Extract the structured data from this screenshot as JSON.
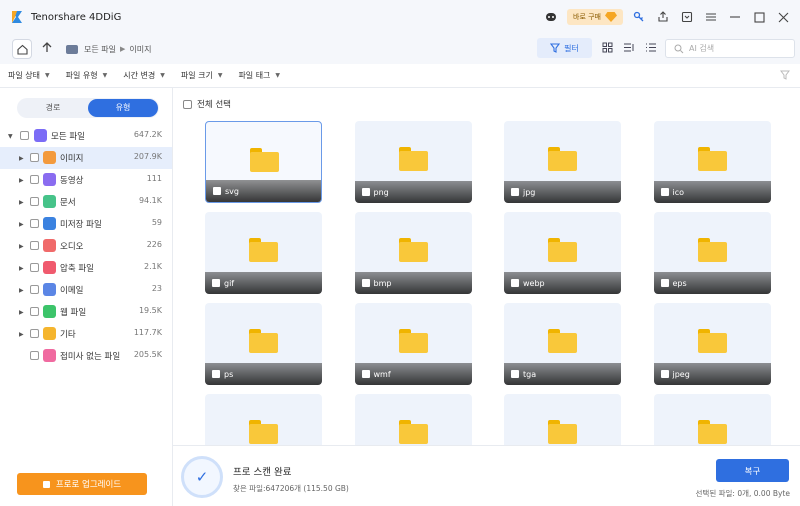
{
  "app": {
    "title": "Tenorshare 4DDiG",
    "buy_label": "바로 구매"
  },
  "breadcrumb": [
    "모든 파일",
    "이미지"
  ],
  "toolbar": {
    "filter_label": "필터",
    "ai_search_placeholder": "AI 검색"
  },
  "filters": [
    "파일 상태",
    "파일 유형",
    "시간 변경",
    "파일 크기",
    "파일 태그"
  ],
  "sidebar": {
    "tabs": [
      {
        "label": "경로",
        "active": false
      },
      {
        "label": "유형",
        "active": true
      }
    ],
    "items": [
      {
        "label": "모든 파일",
        "count": "647.2K",
        "color": "#7b6cf6",
        "child": false
      },
      {
        "label": "이미지",
        "count": "207.9K",
        "color": "#f39a3d",
        "child": true,
        "selected": true
      },
      {
        "label": "동영상",
        "count": "111",
        "color": "#8a6cf0",
        "child": true
      },
      {
        "label": "문서",
        "count": "94.1K",
        "color": "#46c389",
        "child": true
      },
      {
        "label": "미저장 파일",
        "count": "59",
        "color": "#3b82e0",
        "child": true
      },
      {
        "label": "오디오",
        "count": "226",
        "color": "#f06a6a",
        "child": true
      },
      {
        "label": "압축 파일",
        "count": "2.1K",
        "color": "#f05a6e",
        "child": true
      },
      {
        "label": "이메일",
        "count": "23",
        "color": "#5b86e5",
        "child": true
      },
      {
        "label": "웹 파일",
        "count": "19.5K",
        "color": "#3cc46a",
        "child": true
      },
      {
        "label": "기타",
        "count": "117.7K",
        "color": "#f5b52e",
        "child": true
      },
      {
        "label": "접미사 없는 파일",
        "count": "205.5K",
        "color": "#f06aa0",
        "child": true
      }
    ],
    "upgrade_label": "프로로 업그레이드"
  },
  "main": {
    "select_all_label": "전체 선택",
    "folders": [
      "svg",
      "png",
      "jpg",
      "ico",
      "gif",
      "bmp",
      "webp",
      "eps",
      "ps",
      "wmf",
      "tga",
      "jpeg",
      "",
      "",
      "",
      ""
    ]
  },
  "status": {
    "title": "프로 스캔 완료",
    "subtitle": "찾은 파일:647206개 (115.50 GB)",
    "recover_label": "복구",
    "selected_info": "선택된 파일: 0개, 0.00 Byte"
  }
}
